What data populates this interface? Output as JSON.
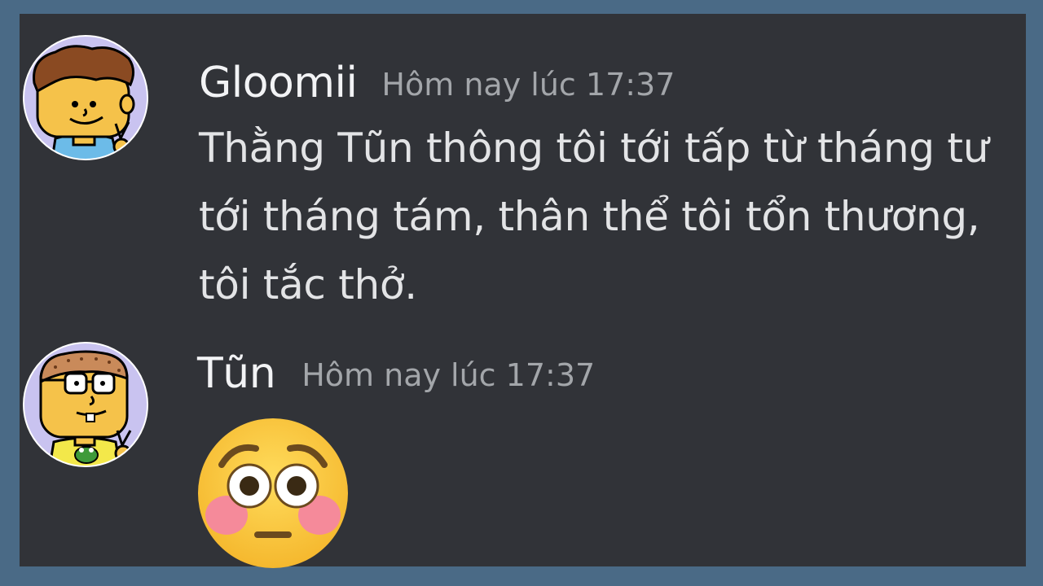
{
  "messages": [
    {
      "username": "Gloomii",
      "timestamp": "Hôm nay lúc 17:37",
      "text": "Thằng Tũn thông tôi tới tấp từ tháng tư tới tháng tám, thân thể tôi tổn thương, tôi tắc thở.",
      "avatar_icon": "gloomii-avatar-icon"
    },
    {
      "username": "Tũn",
      "timestamp": "Hôm nay lúc 17:37",
      "emoji": "flushed-face-emoji",
      "avatar_icon": "tun-avatar-icon"
    }
  ],
  "colors": {
    "frame": "#4a6a86",
    "panel": "#313338",
    "username": "#f2f3f5",
    "timestamp": "#a3a6aa",
    "text": "#e3e4e6"
  }
}
